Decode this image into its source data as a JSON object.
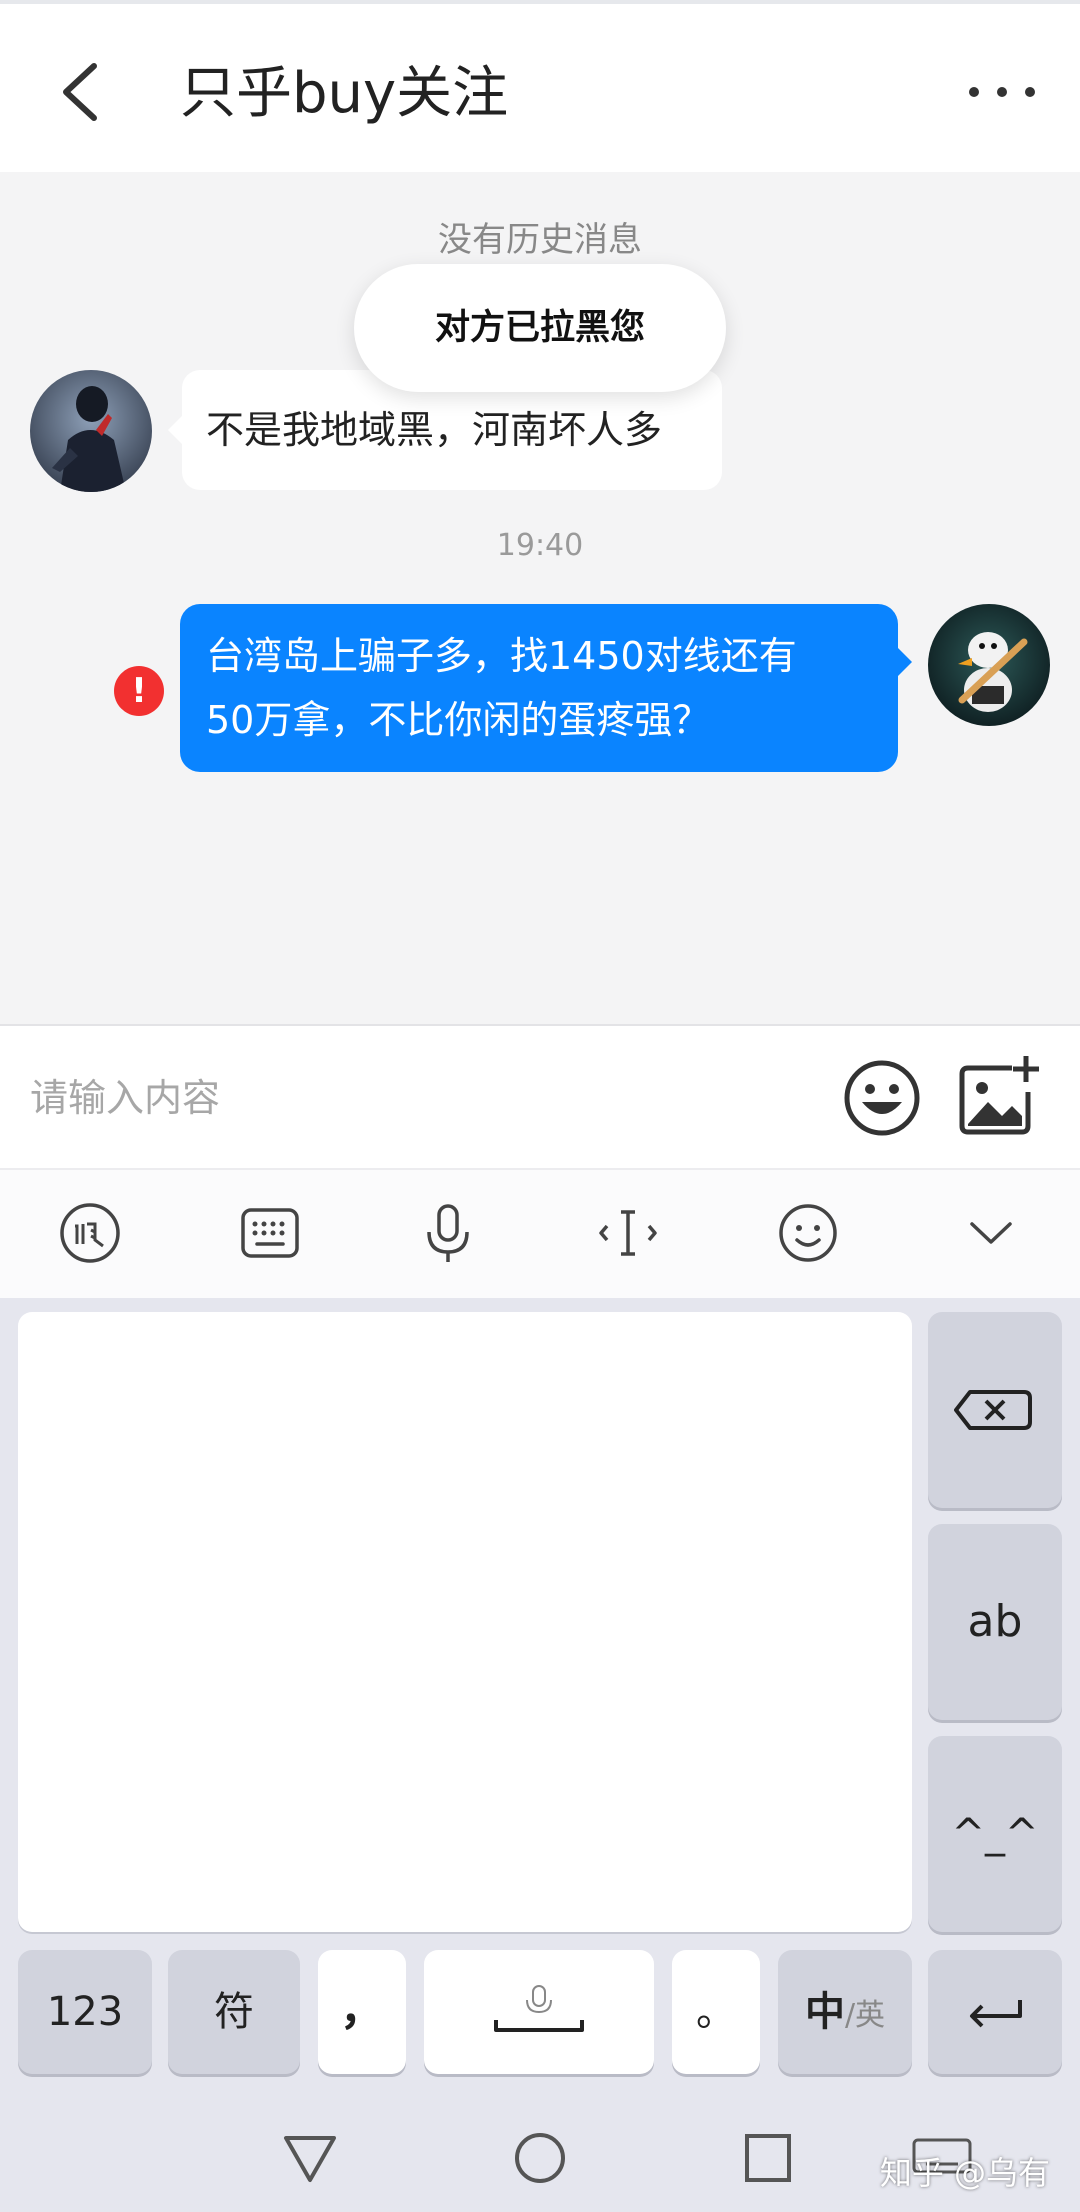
{
  "header": {
    "title": "只乎buy关注"
  },
  "chat": {
    "no_history": "没有历史消息",
    "toast": "对方已拉黑您",
    "messages": [
      {
        "side": "left",
        "text": "不是我地域黑，河南坏人多"
      },
      {
        "side": "right",
        "line1": "台湾岛上骗子多，找1450对线还有",
        "line2": "50万拿，不比你闲的蛋疼强？"
      }
    ],
    "timestamp": "19:40",
    "error_mark": "!"
  },
  "input": {
    "placeholder": "请输入内容"
  },
  "ime_toolbar": {
    "icons": [
      "voice-input-icon",
      "keyboard-icon",
      "microphone-icon",
      "cursor-move-icon",
      "emoji-face-icon",
      "collapse-chevron-icon"
    ]
  },
  "keyboard": {
    "keys": {
      "backspace": "⌫",
      "ab": "ab",
      "kaomoji": "^_^",
      "num": "123",
      "symbol": "符",
      "comma": "，",
      "period": "。",
      "zh": "中",
      "en": "/英",
      "enter": "↵"
    }
  },
  "navbar": {
    "watermark": "知乎 @乌有"
  },
  "colors": {
    "accent_blue": "#0A84FF",
    "error_red": "#F23030",
    "background": "#F4F4F5"
  }
}
